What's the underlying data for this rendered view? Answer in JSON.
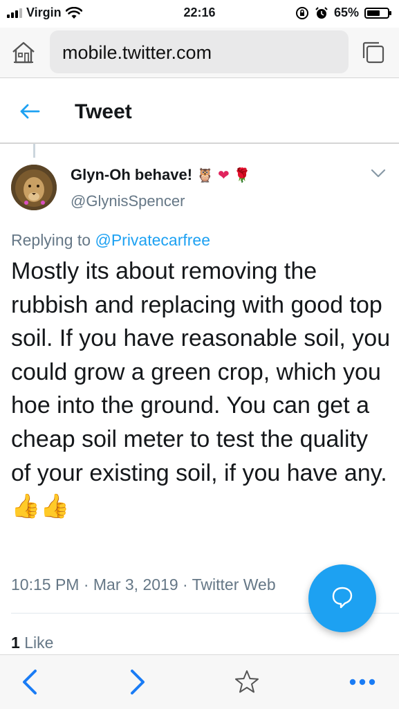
{
  "status_bar": {
    "carrier": "Virgin",
    "time": "22:16",
    "battery_percent": "65%",
    "battery_level": 0.65,
    "icons": [
      "signal-icon",
      "wifi-icon",
      "orientation-lock-icon",
      "alarm-icon",
      "battery-icon"
    ]
  },
  "browser": {
    "url": "mobile.twitter.com",
    "icons": [
      "home-icon",
      "tabs-icon"
    ]
  },
  "header": {
    "title": "Tweet",
    "back_icon": "arrow-left-icon"
  },
  "tweet": {
    "display_name": "Glyn-Oh behave!",
    "name_emojis": [
      "🦉",
      "❤",
      "🌹"
    ],
    "handle": "@GlynisSpencer",
    "replying_prefix": "Replying to",
    "replying_to": "@Privatecarfree",
    "text": "Mostly its about removing the rubbish and replacing with good top soil. If you have reasonable soil, you could grow a green crop, which you hoe into the ground. You can get a cheap soil meter to test the quality of your existing soil, if you have any.",
    "text_emojis": "👍👍",
    "timestamp": "10:15 PM · Mar 3, 2019 · Twitter Web",
    "likes_count": "1",
    "likes_label": "Like"
  },
  "colors": {
    "accent": "#1da1f2",
    "secondary_text": "#657786",
    "primary_text": "#14171a"
  },
  "bottom_bar": {
    "icons": [
      "back-chevron-icon",
      "forward-chevron-icon",
      "star-icon",
      "more-icon"
    ]
  }
}
